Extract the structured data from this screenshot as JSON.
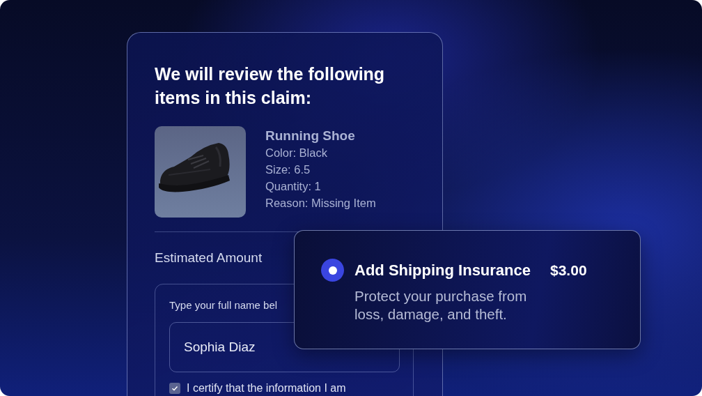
{
  "claim_card": {
    "title": "We will review the following items in this claim:",
    "item": {
      "kind": "picture",
      "name": "Running Shoe",
      "details": [
        "Color: Black",
        "Size: 6.5",
        "Quantity: 1",
        "Reason: Missing Item"
      ]
    },
    "estimated_amount_label": "Estimated Amount",
    "signature": {
      "label": "Type your full name bel",
      "value": "Sophia Diaz"
    },
    "certify": {
      "label": "I certify that the information I am",
      "checked": true
    }
  },
  "insurance_option": {
    "selected": true,
    "title": "Add Shipping Insurance",
    "price": "$3.00",
    "description": "Protect your purchase from loss, damage, and theft."
  }
}
